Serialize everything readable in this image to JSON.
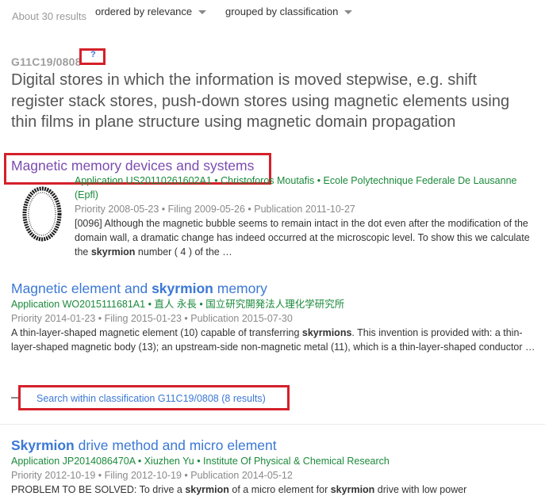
{
  "toolbar": {
    "result_count": "About 30 results",
    "order_dropdown": "ordered by relevance",
    "group_dropdown": "grouped by classification"
  },
  "classification": {
    "code": "G11C19/0808",
    "help": "?",
    "description": "Digital stores in which the information is moved stepwise, e.g. shift register stack stores, push-down stores using magnetic elements using thin films in plane structure using magnetic domain propagation"
  },
  "results": [
    {
      "title": "Magnetic memory devices and systems",
      "meta_line1": "Application US20110261602A1 • Christoforos Moutafis • Ecole Polytechnique Federale De Lausanne",
      "meta_line2": "(Epfl)",
      "dates": "Priority 2008-05-23 • Filing 2009-05-26 • Publication 2011-10-27",
      "snippet_a": "[0096] Although the magnetic bubble seems to remain intact in the dot even after the modification of the domain wall, a dramatic change has indeed occurred at the microscopic level. To show this we calculate the ",
      "snippet_b": "skyrmion",
      "snippet_c": " number ( 4 ) of the …"
    },
    {
      "title_a": "Magnetic element and ",
      "title_b": "skyrmion",
      "title_c": " memory",
      "meta": "Application WO2015111681A1 • 直人 永長 • 国立研究開発法人理化学研究所",
      "dates": "Priority 2014-01-23 • Filing 2015-01-23 • Publication 2015-07-30",
      "snippet_a": "A thin-layer-shaped magnetic element (10) capable of transferring ",
      "snippet_b": "skyrmions",
      "snippet_c": ". This invention is provided with: a thin-layer-shaped magnetic body (13); an upstream-side non-magnetic metal (11), which is a thin-layer-shaped conductor …"
    },
    {
      "title_a": "Skyrmion",
      "title_b": " drive method and micro element",
      "meta": "Application JP2014086470A • Xiuzhen Yu • Institute Of Physical & Chemical Research",
      "dates": "Priority 2012-10-19 • Filing 2012-10-19 • Publication 2014-05-12",
      "snippet_a": "PROBLEM TO BE SOLVED: To drive a ",
      "snippet_b": "skyrmion",
      "snippet_c": " of a micro element for ",
      "snippet_d": "skyrmion",
      "snippet_e": " drive with low power"
    }
  ],
  "search_within": "Search within classification G11C19/0808 (8 results)",
  "colors": {
    "link": "#3b78d6",
    "visited": "#7b4bb0",
    "meta_green": "#1b8a3b",
    "highlight_box": "#d4202a"
  }
}
